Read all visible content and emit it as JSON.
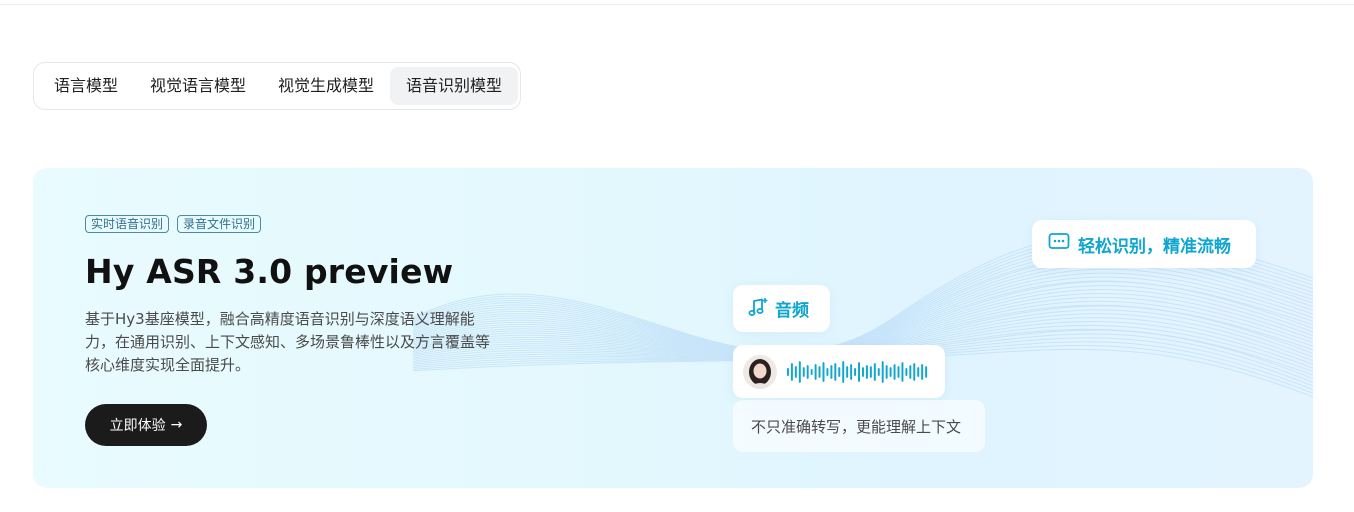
{
  "tabs": [
    {
      "label": "语言模型",
      "active": false
    },
    {
      "label": "视觉语言模型",
      "active": false
    },
    {
      "label": "视觉生成模型",
      "active": false
    },
    {
      "label": "语音识别模型",
      "active": true
    }
  ],
  "hero": {
    "tags": [
      "实时语音识别",
      "录音文件识别"
    ],
    "title": "Hy ASR 3.0 preview",
    "description": "基于Hy3基座模型，融合高精度语音识别与深度语义理解能力，在通用识别、上下文感知、多场景鲁棒性以及方言覆盖等核心维度实现全面提升。",
    "cta_label": "立即体验",
    "cta_arrow": "→"
  },
  "cards": {
    "easy_label": "轻松识别，精准流畅",
    "audio_label": "音频",
    "caption": "不只准确转写，更能理解上下文"
  },
  "icons": {
    "chat": "chat-dots-icon",
    "music": "music-note-plus-icon",
    "waveform": "audio-waveform-icon",
    "avatar": "user-avatar"
  },
  "colors": {
    "accent": "#0fa6cf",
    "cta_bg": "#1b1b1b",
    "hero_bg": "#e6f9fe",
    "active_tab_bg": "#f1f2f4"
  }
}
